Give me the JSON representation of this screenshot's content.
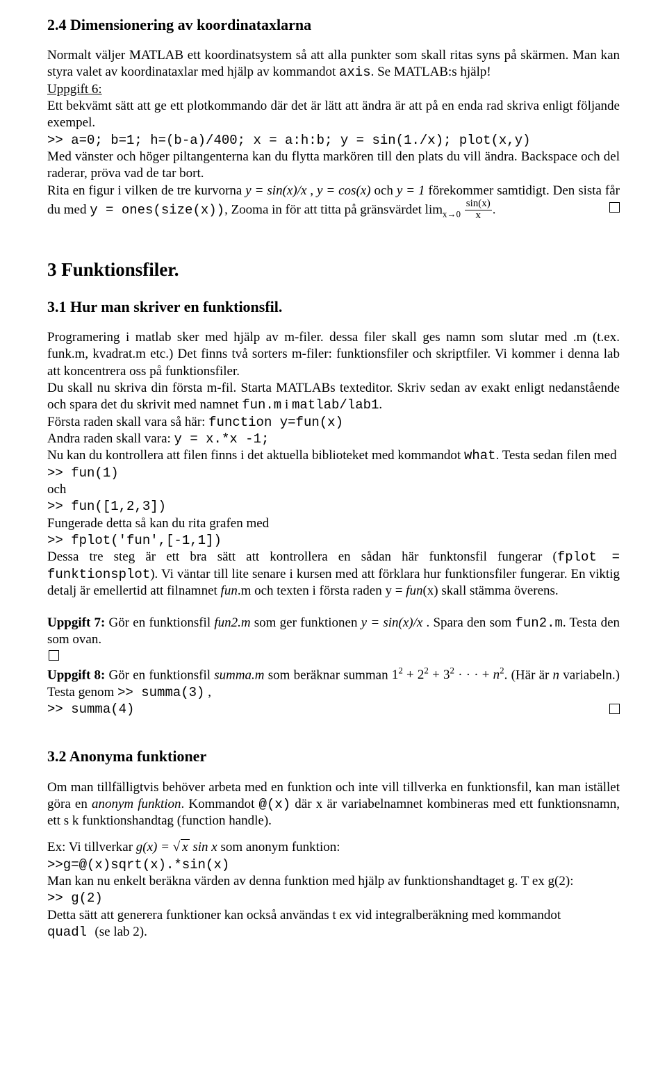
{
  "s24": {
    "heading": "2.4   Dimensionering av koordinataxlarna",
    "p1a": "Normalt väljer MATLAB ett koordinatsystem så att alla punkter som skall ritas syns på skärmen. Man kan styra valet av koordinataxlar med hjälp av kommandot ",
    "p1_cmd": "axis",
    "p1b": ". Se MATLAB:s hjälp!",
    "u6_label": "Uppgift 6:",
    "u6_p1": "Ett bekvämt sätt att ge ett plotkommando där det är lätt att ändra är att på en enda rad skriva enligt följande exempel.",
    "u6_code": ">> a=0; b=1; h=(b-a)/400; x = a:h:b; y = sin(1./x); plot(x,y)",
    "u6_p2": "Med vänster och höger piltangenterna kan du flytta markören till den plats du vill ändra. Backspace och del raderar, pröva vad de tar bort.",
    "u6_p3a": "Rita en figur i vilken de tre kurvorna  ",
    "u6_eq1": "y = sin(x)/x",
    "u6_p3b": " ,  ",
    "u6_eq2": "y = cos(x)",
    "u6_p3c": "  och  ",
    "u6_eq3": "y = 1",
    "u6_p3d": "  förekommer samtidigt. Den sista får du med ",
    "u6_code2": "y = ones(size(x))",
    "u6_p3e": ", Zooma in för att titta på gränsvärdet lim",
    "u6_lim_sub": "x→0",
    "u6_frac_num": "sin(x)",
    "u6_frac_den": "x",
    "u6_p3f": "."
  },
  "s3": {
    "heading": "3   Funktionsfiler."
  },
  "s31": {
    "heading": "3.1   Hur man skriver en funktionsfil.",
    "p1": "Programering i matlab sker med hjälp av m-filer. dessa filer skall ges namn som slutar med .m (t.ex. funk.m, kvadrat.m etc.) Det finns två sorters m-filer: funktionsfiler och skriptfiler. Vi kommer i denna lab att koncentrera oss på funktionsfiler.",
    "p2a": "Du skall nu skriva din första m-fil. Starta MATLABs texteditor. Skriv sedan av exakt enligt nedanstående och spara det du skrivit med namnet ",
    "p2_code1": "fun.m",
    "p2b": " i ",
    "p2_code2": "matlab/lab1",
    "p2c": ".",
    "p3": "Första raden skall vara så här:    ",
    "p3_code": "function y=fun(x)",
    "p4": "Andra raden skall vara:    ",
    "p4_code": "y = x.*x -1;",
    "p5a": "Nu kan du kontrollera att filen finns i det aktuella biblioteket med kommandot ",
    "p5_code": "what",
    "p5b": ". Testa sedan filen med",
    "code1": ">> fun(1)",
    "och": "och",
    "code2": ">> fun([1,2,3])",
    "p6": "Fungerade detta så kan du rita grafen med",
    "code3": ">> fplot('fun',[-1,1])",
    "p7a": "Dessa tre steg är ett bra sätt att kontrollera en sådan här funktonsfil fungerar (",
    "p7_code": "fplot = funktionsplot",
    "p7b": "). Vi väntar till lite senare i kursen med att förklara hur funktionsfiler fungerar. En viktig detalj är emellertid att filnamnet ",
    "p7_em1": "fun",
    "p7c": ".m och texten i första raden y = ",
    "p7_em2": "fun",
    "p7d": "(x) skall stämma överens.",
    "u7_label": "Uppgift 7: ",
    "u7a": "Gör en funktionsfil ",
    "u7_em": "fun2.m",
    "u7b": " som ger funktionen  ",
    "u7_eq": "y = sin(x)/x",
    "u7c": " . Spara den som   ",
    "u7_code": "fun2.m",
    "u7d": ". Testa den som ovan.",
    "u8_label": "Uppgift 8: ",
    "u8a": "Gör en funktionsfil ",
    "u8_em": "summa.m",
    "u8b": " som beräknar summan ",
    "u8_eq": "1² + 2² + 3² · · · + n²",
    "u8c": ". (Här är ",
    "u8_var": "n",
    "u8d": " variabeln.) Testa genom ",
    "u8_code1": ">> summa(3)",
    "u8e": "   ,",
    "u8_code2": ">> summa(4)"
  },
  "s32": {
    "heading": "3.2   Anonyma funktioner",
    "p1a": "Om man tillfälligtvis behöver arbeta med en funktion och inte vill tillverka en funktionsfil, kan man istället göra en ",
    "p1_em": "anonym funktion",
    "p1b": ". Kommandot   ",
    "p1_code": "@(x)",
    "p1c": "   där x är variabelnamnet kombineras med ett funktionsnamn, ett s k funktionshandtag (function handle).",
    "ex_label": "Ex:  ",
    "ex_a": "Vi tillverkar ",
    "ex_eq_g": "g(x) = ",
    "ex_eq_sqrt": "√x",
    "ex_eq_rest": " sin x",
    "ex_b": " som anonym funktion:",
    "ex_code": ">>g=@(x)sqrt(x).*sin(x)",
    "p2": "Man kan nu enkelt beräkna värden av denna funktion med hjälp av funktionshandtaget g. T ex g(2):",
    "code_g2": ">> g(2)",
    "p3a": "Detta sätt att generera funktioner kan också användas t ex vid integralberäkning med kommandot ",
    "p3_code": " quadl ",
    "p3b": "(se lab 2)."
  }
}
